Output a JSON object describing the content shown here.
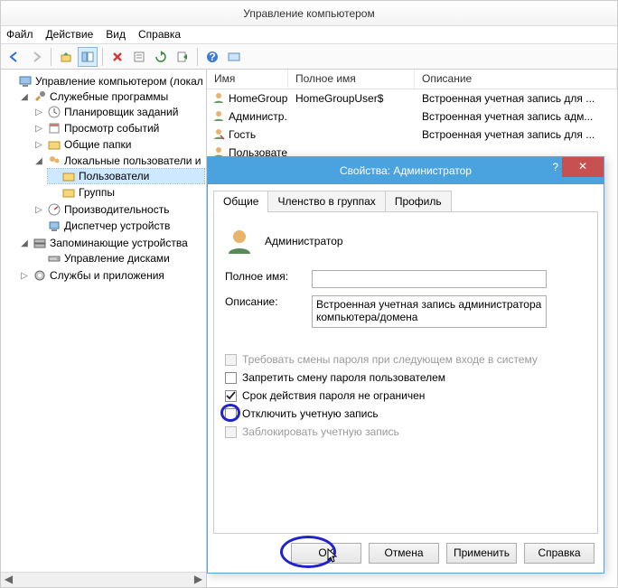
{
  "window_title": "Управление компьютером",
  "menu": {
    "file": "Файл",
    "action": "Действие",
    "view": "Вид",
    "help": "Справка"
  },
  "tree": {
    "root": "Управление компьютером (локал",
    "services_group": "Служебные программы",
    "task_sched": "Планировщик заданий",
    "event_viewer": "Просмотр событий",
    "shared_folders": "Общие папки",
    "local_users": "Локальные пользователи и",
    "users": "Пользователи",
    "groups": "Группы",
    "perf": "Производительность",
    "devmgr": "Диспетчер устройств",
    "storage": "Запоминающие устройства",
    "diskmgmt": "Управление дисками",
    "svcapps": "Службы и приложения"
  },
  "list": {
    "hdr_name": "Имя",
    "hdr_fullname": "Полное имя",
    "hdr_desc": "Описание",
    "rows": [
      {
        "name": "HomeGroup...",
        "full": "HomeGroupUser$",
        "desc": "Встроенная учетная запись для ..."
      },
      {
        "name": "Администр...",
        "full": "",
        "desc": "Встроенная учетная запись адм..."
      },
      {
        "name": "Гость",
        "full": "",
        "desc": "Встроенная учетная запись для ..."
      },
      {
        "name": "Пользовате...",
        "full": "",
        "desc": ""
      }
    ]
  },
  "dialog": {
    "title": "Свойства: Администратор",
    "tabs": {
      "general": "Общие",
      "member": "Членство в группах",
      "profile": "Профиль"
    },
    "username": "Администратор",
    "fullname_label": "Полное имя:",
    "fullname_value": "",
    "desc_label": "Описание:",
    "desc_value": "Встроенная учетная запись администратора компьютера/домена",
    "chk_mustchange": "Требовать смены пароля при следующем входе в систему",
    "chk_nochange": "Запретить смену пароля пользователем",
    "chk_neverexpire": "Срок действия пароля не ограничен",
    "chk_disable": "Отключить учетную запись",
    "chk_locked": "Заблокировать учетную запись",
    "btn_ok": "OK",
    "btn_cancel": "Отмена",
    "btn_apply": "Применить",
    "btn_help": "Справка"
  }
}
